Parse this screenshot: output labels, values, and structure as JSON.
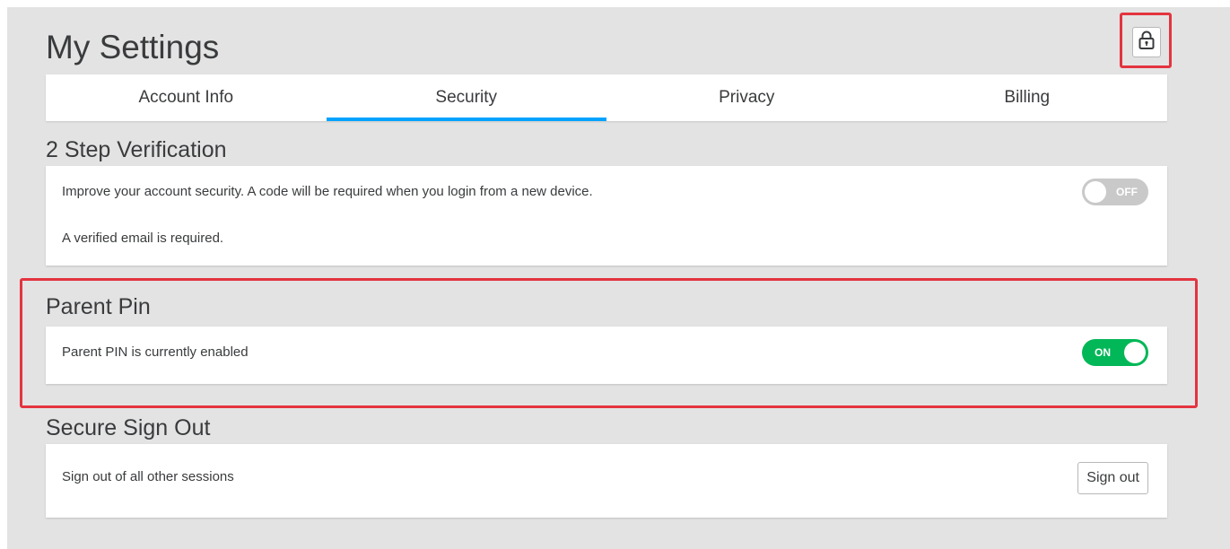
{
  "page": {
    "title": "My Settings",
    "lock_icon": "lock-icon"
  },
  "tabs": [
    {
      "label": "Account Info",
      "active": false
    },
    {
      "label": "Security",
      "active": true
    },
    {
      "label": "Privacy",
      "active": false
    },
    {
      "label": "Billing",
      "active": false
    }
  ],
  "two_step": {
    "title": "2 Step Verification",
    "description": "Improve your account security. A code will be required when you login from a new device.",
    "note": "A verified email is required.",
    "toggle_label": "OFF",
    "enabled": false
  },
  "parent_pin": {
    "title": "Parent Pin",
    "status": "Parent PIN is currently enabled",
    "toggle_label": "ON",
    "enabled": true
  },
  "secure_sign_out": {
    "title": "Secure Sign Out",
    "description": "Sign out of all other sessions",
    "button_label": "Sign out"
  },
  "colors": {
    "background": "#e3e3e3",
    "tab_active_underline": "#00a2ff",
    "toggle_on": "#02b757",
    "toggle_off": "#c9c9c9",
    "highlight": "#e3343f",
    "text": "#393b3d"
  }
}
